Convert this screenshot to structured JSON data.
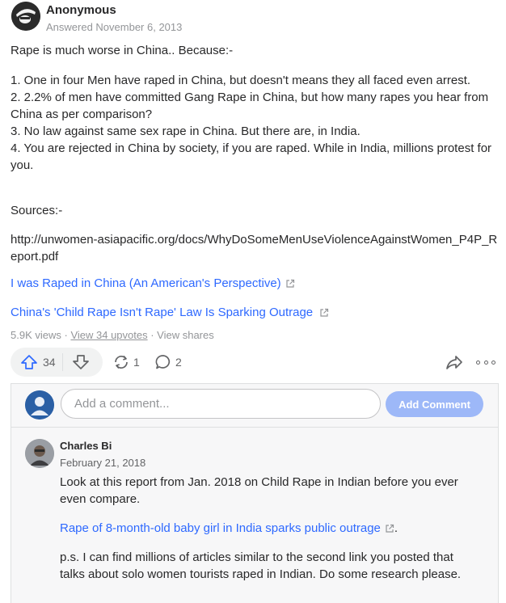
{
  "answer": {
    "author": "Anonymous",
    "date": "Answered November 6, 2013",
    "intro": "Rape is much worse in China.. Because:-",
    "list": [
      "1. One in four Men have raped in China, but doesn't means they all faced even arrest.",
      "2. 2.2% of men have committed Gang Rape in China, but how many rapes you hear from China as per comparison?",
      "3. No law against same sex rape in China. But there are, in India.",
      "4. You are rejected in China by society, if you are raped. While in India, millions protest for you."
    ],
    "sources_label": "Sources:-",
    "source_url": "http://unwomen-asiapacific.org/docs/WhyDoSomeMenUseViolenceAgainstWomen_P4P_Report.pdf",
    "links": [
      "I was Raped in China (An American's Perspective)",
      "China's 'Child Rape Isn't Rape' Law Is Sparking Outrage"
    ]
  },
  "meta": {
    "views": "5.9K views",
    "sep1": " · ",
    "upvotes_link": "View 34 upvotes",
    "sep2": " · ",
    "shares": "View shares"
  },
  "actions": {
    "upvotes": "34",
    "reshares": "1",
    "comments": "2",
    "icons": [
      "upvote-icon",
      "downvote-icon",
      "reshare-icon",
      "comment-icon",
      "share-icon",
      "more-icon"
    ]
  },
  "comment_box": {
    "placeholder": "Add a comment...",
    "button": "Add Comment"
  },
  "comment": {
    "author": "Charles Bi",
    "date": "February 21, 2018",
    "p1": "Look at this report from Jan. 2018 on Child Rape in Indian before you ever even compare.",
    "link": "Rape of 8-month-old baby girl in India sparks public outrage",
    "link_suffix": ".",
    "p3": "p.s. I can find millions of articles similar to the second link you posted that talks about solo women tourists raped in Indian. Do some research please."
  },
  "colors": {
    "link": "#2e69ff",
    "muted": "#939598",
    "text": "#282829",
    "button_disabled": "#9db8f8"
  }
}
